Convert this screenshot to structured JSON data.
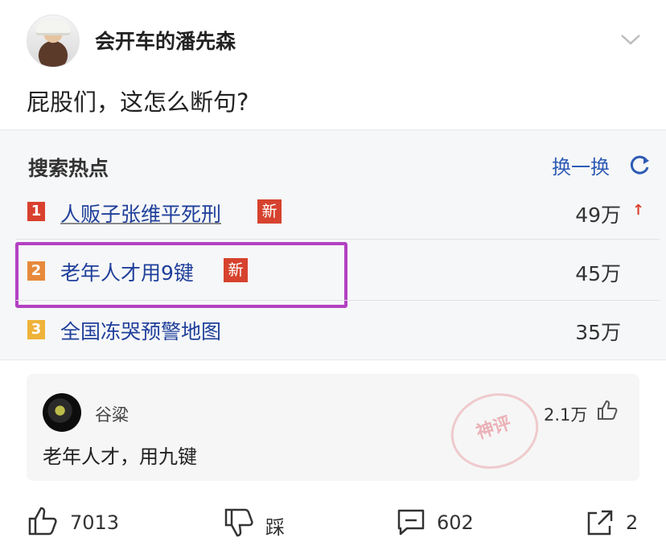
{
  "post": {
    "author": "会开车的潘先森",
    "text": "屁股们，这怎么断句?"
  },
  "hot_search": {
    "title": "搜索热点",
    "refresh_label": "换一换",
    "items": [
      {
        "rank": "1",
        "topic": "人贩子张维平死刑",
        "tag": "新",
        "count": "49万",
        "trend": "up"
      },
      {
        "rank": "2",
        "topic": "老年人才用9键",
        "tag": "新",
        "count": "45万"
      },
      {
        "rank": "3",
        "topic": "全国冻哭预警地图",
        "count": "35万"
      }
    ],
    "highlight_color": "#b341c2"
  },
  "comment": {
    "user": "谷粱",
    "text": "老年人才，用九键",
    "likes": "2.1万",
    "stamp": "神评"
  },
  "actions": {
    "like_count": "7013",
    "dislike_label": "踩",
    "comment_count": "602",
    "share_count": "2"
  },
  "colors": {
    "link_blue": "#1f3f9a",
    "hot_red": "#d9402e"
  }
}
